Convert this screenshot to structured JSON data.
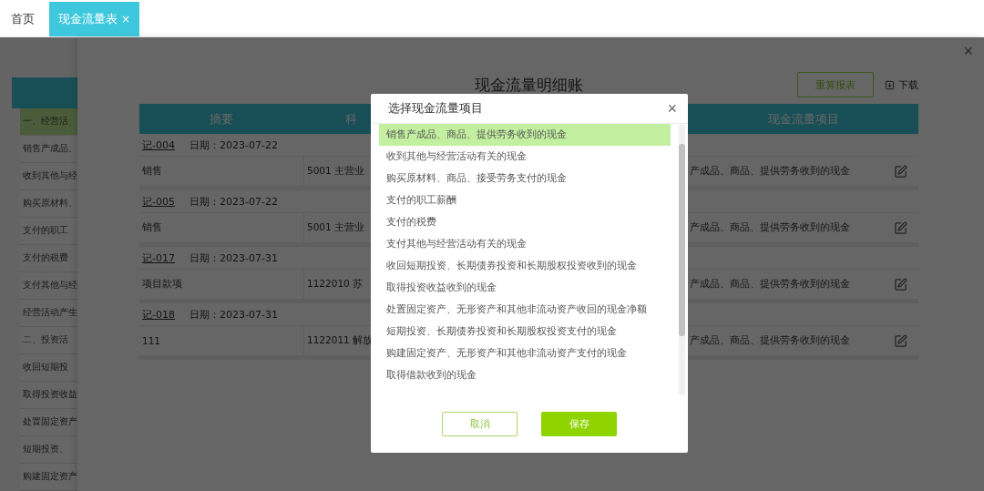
{
  "tabs": [
    {
      "label": "首页",
      "selected": false
    },
    {
      "label": "现金流量表",
      "close_label": "×",
      "selected": true
    }
  ],
  "sidebar": {
    "items": [
      {
        "label": "一、经营活",
        "selected": true
      },
      {
        "label": "销售产成品、",
        "selected": false
      },
      {
        "label": "收到其他与经",
        "selected": false
      },
      {
        "label": "购买原材料、",
        "selected": false
      },
      {
        "label": "支付的职工",
        "selected": false
      },
      {
        "label": "支付的税费",
        "selected": false
      },
      {
        "label": "支付其他与经",
        "selected": false
      },
      {
        "label": "经营活动产生",
        "selected": false
      },
      {
        "label": "二、投资活",
        "selected": false
      },
      {
        "label": "收回短期投",
        "selected": false
      },
      {
        "label": "取得投资收益",
        "selected": false
      },
      {
        "label": "处置固定资产",
        "selected": false
      },
      {
        "label": "短期投资、",
        "selected": false
      },
      {
        "label": "购建固定资产",
        "selected": false
      }
    ]
  },
  "drawer": {
    "close_label": "×",
    "title": "现金流量明细账",
    "recalc_button": "重算报表",
    "download_button": "下载"
  },
  "table": {
    "columns": [
      "摘要",
      "科",
      "现金流量项目"
    ],
    "groups": [
      {
        "voucher": "记-004",
        "date": "日期：2023-07-22",
        "rows": [
          {
            "summary": "销售",
            "account": "5001 主营业",
            "cash_item": "产成品、商品、提供劳务收到的现金"
          }
        ]
      },
      {
        "voucher": "记-005",
        "date": "日期：2023-07-22",
        "rows": [
          {
            "summary": "销售",
            "account": "5001 主营业",
            "cash_item": "产成品、商品、提供劳务收到的现金"
          }
        ]
      },
      {
        "voucher": "记-017",
        "date": "日期：2023-07-31",
        "rows": [
          {
            "summary": "项目款项",
            "account": "1122010 苏",
            "cash_item": "产成品、商品、提供劳务收到的现金"
          }
        ]
      },
      {
        "voucher": "记-018",
        "date": "日期：2023-07-31",
        "rows": [
          {
            "summary": "111",
            "account": "1122011 解放",
            "cash_item": "产成品、商品、提供劳务收到的现金"
          }
        ]
      }
    ]
  },
  "modal": {
    "title": "选择现金流量项目",
    "close_label": "×",
    "items": [
      {
        "label": "销售产成品、商品、提供劳务收到的现金",
        "selected": true
      },
      {
        "label": "收到其他与经营活动有关的现金",
        "selected": false
      },
      {
        "label": "购买原材料、商品、接受劳务支付的现金",
        "selected": false
      },
      {
        "label": "支付的职工薪酬",
        "selected": false
      },
      {
        "label": "支付的税费",
        "selected": false
      },
      {
        "label": "支付其他与经营活动有关的现金",
        "selected": false
      },
      {
        "label": "收回短期投资、长期债券投资和长期股权投资收到的现金",
        "selected": false
      },
      {
        "label": "取得投资收益收到的现金",
        "selected": false
      },
      {
        "label": "处置固定资产、无形资产和其他非流动资产收回的现金净额",
        "selected": false
      },
      {
        "label": "短期投资、长期债券投资和长期股权投资支付的现金",
        "selected": false
      },
      {
        "label": "购建固定资产、无形资产和其他非流动资产支付的现金",
        "selected": false
      },
      {
        "label": "取得借款收到的现金",
        "selected": false
      }
    ],
    "cancel_button": "取消",
    "save_button": "保存"
  }
}
